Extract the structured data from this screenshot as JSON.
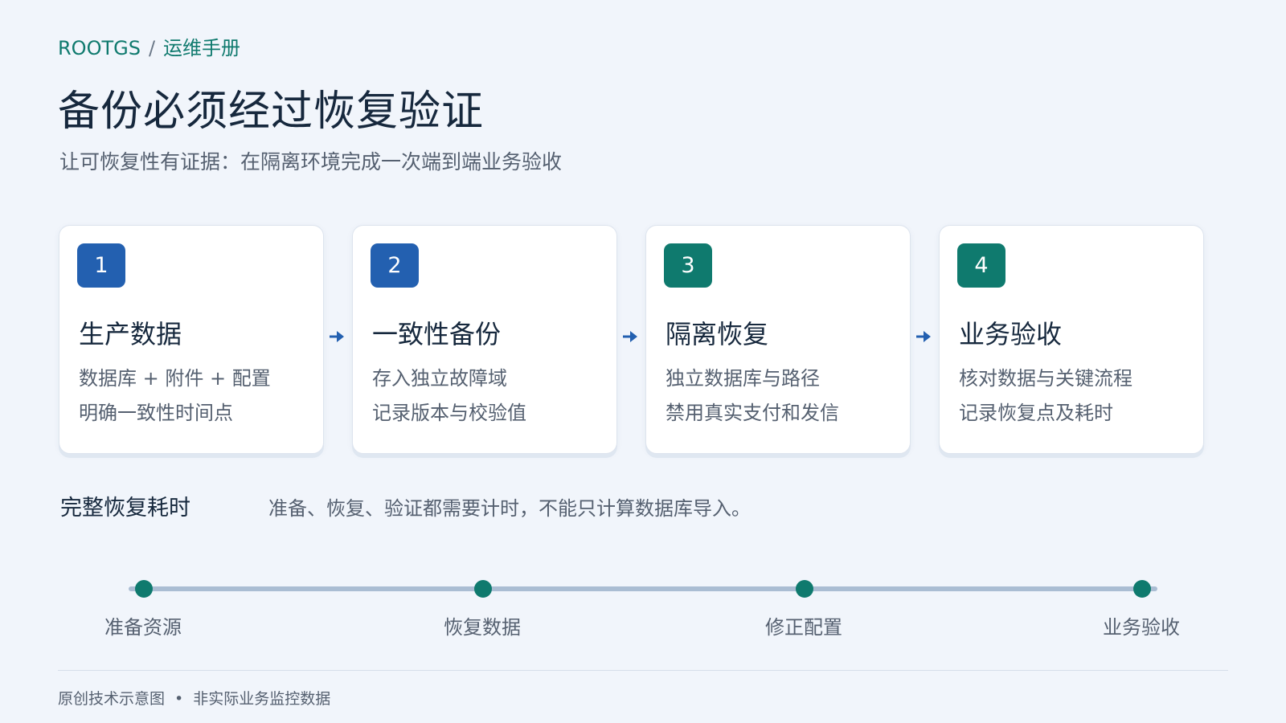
{
  "breadcrumb": {
    "org": "ROOTGS",
    "separator": "/",
    "section": "运维手册"
  },
  "title": "备份必须经过恢复验证",
  "subtitle": "让可恢复性有证据：在隔离环境完成一次端到端业务验收",
  "steps": [
    {
      "number": "1",
      "title": "生产数据",
      "line1": "数据库 + 附件 + 配置",
      "line2": "明确一致性时间点",
      "badge_color": "#2360b0"
    },
    {
      "number": "2",
      "title": "一致性备份",
      "line1": "存入独立故障域",
      "line2": "记录版本与校验值",
      "badge_color": "#2360b0"
    },
    {
      "number": "3",
      "title": "隔离恢复",
      "line1": "独立数据库与路径",
      "line2": "禁用真实支付和发信",
      "badge_color": "#0f7a6e"
    },
    {
      "number": "4",
      "title": "业务验收",
      "line1": "核对数据与关键流程",
      "line2": "记录恢复点及耗时",
      "badge_color": "#0f7a6e"
    }
  ],
  "duration": {
    "label": "完整恢复耗时",
    "note": "准备、恢复、验证都需要计时，不能只计算数据库导入。"
  },
  "timeline": {
    "stages": [
      "准备资源",
      "恢复数据",
      "修正配置",
      "业务验收"
    ]
  },
  "footer": {
    "left": "原创技术示意图",
    "separator": "•",
    "right": "非实际业务监控数据"
  },
  "colors": {
    "accent_blue": "#2360b0",
    "accent_teal": "#0f7a6e",
    "track": "#aabdd3"
  }
}
